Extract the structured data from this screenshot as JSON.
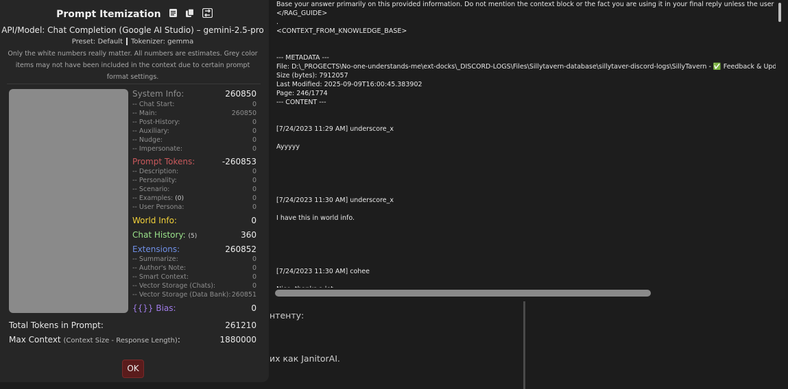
{
  "background": {
    "fragment1": "нтенту:",
    "fragment2": "их как JanitorAI."
  },
  "popup": {
    "title": "Prompt Itemization",
    "icons": [
      "document-icon",
      "copy-icon",
      "swap-icon"
    ],
    "model_line": "API/Model: Chat Completion (Google AI Studio) – gemini-2.5-pro",
    "preset_label": "Preset: Default",
    "tokenizer_label": "Tokenizer: gemma",
    "note": "Only the white numbers really matter. All numbers are estimates. Grey color items may not have been included in the context due to certain prompt format settings.",
    "system_info": {
      "label": "System Info:",
      "value": "260850",
      "items": [
        {
          "label": "-- Chat Start:",
          "value": "0"
        },
        {
          "label": "-- Main:",
          "value": "260850"
        },
        {
          "label": "-- Post-History:",
          "value": "0"
        },
        {
          "label": "-- Auxiliary:",
          "value": "0"
        },
        {
          "label": "-- Nudge:",
          "value": "0"
        },
        {
          "label": "-- Impersonate:",
          "value": "0"
        }
      ]
    },
    "prompt_tokens": {
      "label": "Prompt Tokens:",
      "value": "-260853",
      "items": [
        {
          "label": "-- Description:",
          "value": "0"
        },
        {
          "label": "-- Personality:",
          "value": "0"
        },
        {
          "label": "-- Scenario:",
          "value": "0"
        },
        {
          "label": "-- Examples:",
          "extra": "(0)",
          "value": "0"
        },
        {
          "label": "-- User Persona:",
          "value": "0"
        }
      ]
    },
    "world_info": {
      "label": "World Info:",
      "value": "0"
    },
    "chat_history": {
      "label": "Chat History:",
      "extra": "(5)",
      "value": "360"
    },
    "extensions": {
      "label": "Extensions:",
      "value": "260852",
      "items": [
        {
          "label": "-- Summarize:",
          "value": "0"
        },
        {
          "label": "-- Author's Note:",
          "value": "0"
        },
        {
          "label": "-- Smart Context:",
          "value": "0"
        },
        {
          "label": "-- Vector Storage (Chats):",
          "value": "0"
        },
        {
          "label": "-- Vector Storage (Data Bank):",
          "value": "260851"
        }
      ]
    },
    "bias": {
      "label": "{{}} Bias:",
      "value": "0"
    },
    "total": {
      "label": "Total Tokens in Prompt:",
      "value": "261210"
    },
    "max_context": {
      "label": "Max Context",
      "hint": "(Context Size - Response Length)",
      "colon": ":",
      "value": "1880000"
    },
    "ok_label": "OK"
  },
  "viewer": {
    "text": "Base your answer primarily on this provided information. Do not mention the context block or the fact you are using it in your final reply unless the user specificall\n</RAG_GUIDE>\n.\n<CONTEXT_FROM_KNOWLEDGE_BASE>\n\n\n--- METADATA ---\nFile: D:\\_PROGECTS\\No-one-understands-me\\ext-docks\\_DISCORD-LOGS\\Files\\Sillytavern-database\\sillytaver-discord-logs\\SillyTavern - ✅ Feedback & Updates - sil\nSize (bytes): 7912057\nLast Modified: 2025-09-09T16:00:45.383902\nPage: 246/1774\n--- CONTENT ---\n\n\n[7/24/2023 11:29 AM] underscore_x\n\nAyyyyy\n\n\n\n\n\n[7/24/2023 11:30 AM] underscore_x\n\nI have this in world info.\n\n\n\n\n\n[7/24/2023 11:30 AM] cohee\n\nNice, thanks a lot"
  }
}
